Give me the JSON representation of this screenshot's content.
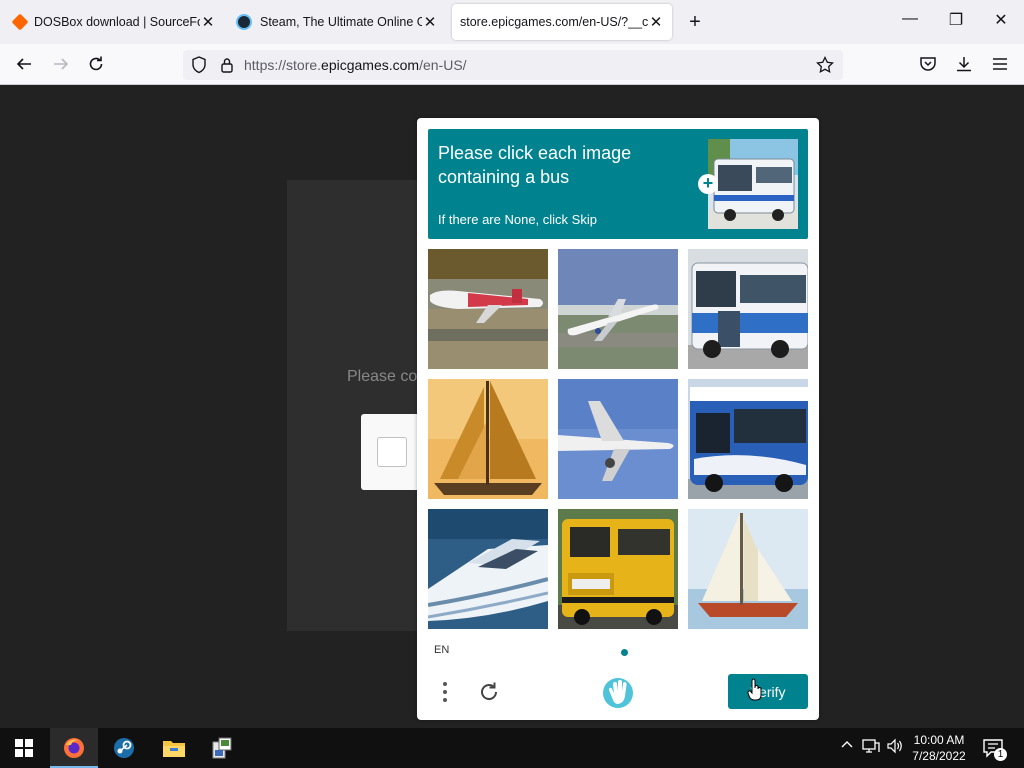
{
  "browser": {
    "tabs": [
      {
        "title": "DOSBox download | SourceForg",
        "active": false,
        "favicon": "sourceforge-icon"
      },
      {
        "title": "Steam, The Ultimate Online Gam",
        "active": false,
        "favicon": "steam-icon"
      },
      {
        "title": "store.epicgames.com/en-US/?__cf_",
        "active": true,
        "favicon": ""
      }
    ],
    "close_glyph": "✕",
    "new_tab_glyph": "+",
    "window_controls": {
      "minimize": "—",
      "maximize": "❐",
      "close": "✕"
    },
    "url": {
      "prefix": "https://store.",
      "host": "epicgames.com",
      "path": "/en-US/"
    }
  },
  "page": {
    "behind_text": "Please co"
  },
  "captcha": {
    "prompt_title": "Please click each image containing a bus",
    "prompt_sub": "If there are None, click Skip",
    "plus_badge": "+",
    "tiles": [
      {
        "name": "tile-airplane-red"
      },
      {
        "name": "tile-airplane-takeoff"
      },
      {
        "name": "tile-bus-blue-white"
      },
      {
        "name": "tile-sailboat-orange"
      },
      {
        "name": "tile-airplane-flying"
      },
      {
        "name": "tile-bus-blue-city"
      },
      {
        "name": "tile-motor-yacht"
      },
      {
        "name": "tile-school-bus-yellow"
      },
      {
        "name": "tile-sailboat-white"
      }
    ],
    "language": "EN",
    "verify_label": "Verify",
    "accent_color": "#00838f"
  },
  "taskbar": {
    "items": [
      "windows-start-icon",
      "firefox-icon",
      "steam-icon",
      "file-explorer-icon",
      "app-installer-icon"
    ],
    "active_item": "firefox-icon",
    "clock_time": "10:00 AM",
    "clock_date": "7/28/2022",
    "notification_count": "1"
  }
}
